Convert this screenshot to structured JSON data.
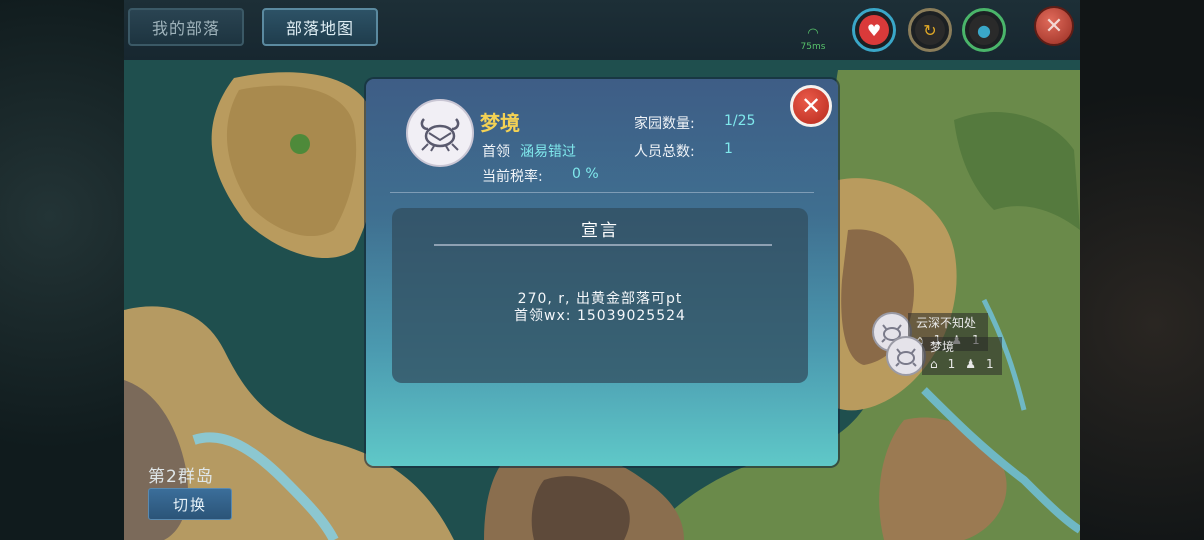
{
  "tabs": [
    {
      "label": "我的部落",
      "active": false
    },
    {
      "label": "部落地图",
      "active": true
    }
  ],
  "hud": {
    "ping": "75ms",
    "stats": [
      {
        "name": "health",
        "icon": "heart-icon",
        "color": "#d93a3a"
      },
      {
        "name": "hunger",
        "icon": "food-icon",
        "color": "#e0a826"
      },
      {
        "name": "water",
        "icon": "water-drop-icon",
        "color": "#3aa7c8"
      }
    ],
    "close_label": "✕"
  },
  "map": {
    "island_label": "第2群岛",
    "switch_label": "切换",
    "markers": [
      {
        "name": "云深不知处",
        "homes": "1",
        "members": "1"
      },
      {
        "name": "梦境",
        "homes": "1",
        "members": "1"
      }
    ]
  },
  "dialog": {
    "tribe_name": "梦境",
    "leader_label": "首领",
    "leader_name": "涵易错过",
    "tax_label": "当前税率:",
    "tax_value": "0 %",
    "homes_label": "家园数量:",
    "homes_value": "1/25",
    "members_label": "人员总数:",
    "members_value": "1",
    "close_label": "✕",
    "declaration_title": "宣言",
    "declaration_lines": [
      "270, r, 出黄金部落可pt",
      "首领wx: 15039025524"
    ]
  }
}
